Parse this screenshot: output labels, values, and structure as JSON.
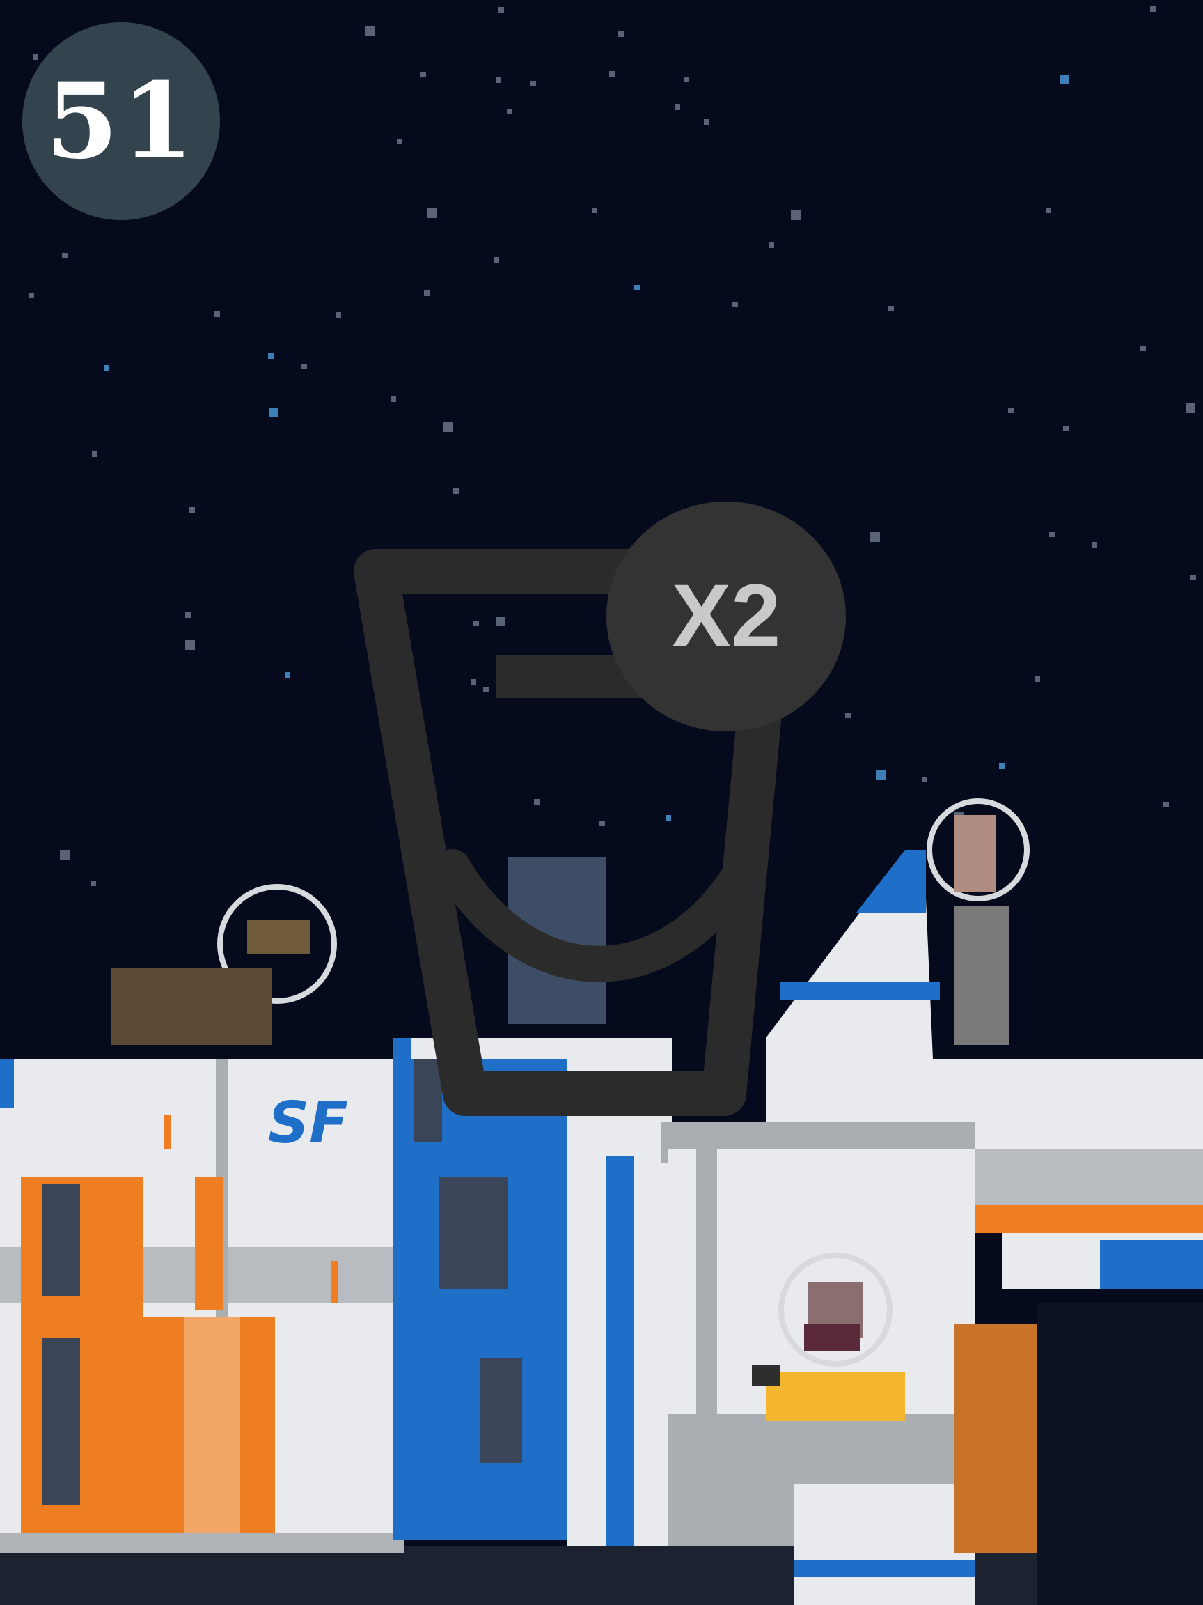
{
  "hud": {
    "score": "51",
    "multiplier": "X2",
    "center_icon": "cup-icon",
    "score_badge_color": "#34444f",
    "multiplier_badge_color": "#333333",
    "cup_color": "#2b2b2b"
  },
  "scene": {
    "sky_color": "#050a1c",
    "ship_logo": "SF",
    "palette": {
      "hull_white": "#e8eaed",
      "hull_grey": "#a9aeb3",
      "accent_blue": "#1f6fc9",
      "accent_orange": "#ef7d22",
      "dark_panel": "#3a4658"
    }
  }
}
